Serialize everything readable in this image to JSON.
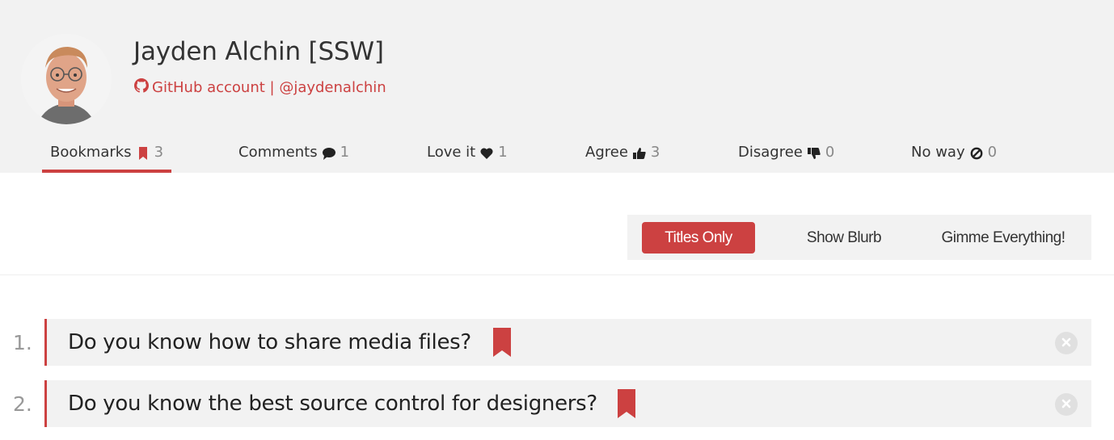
{
  "profile": {
    "name": "Jayden Alchin [SSW]",
    "github_text": "GitHub account | @jaydenalchin"
  },
  "tabs": [
    {
      "label": "Bookmarks",
      "count": "3",
      "icon": "bookmark-icon",
      "active": true
    },
    {
      "label": "Comments",
      "count": "1",
      "icon": "comment-icon",
      "active": false
    },
    {
      "label": "Love it",
      "count": "1",
      "icon": "heart-icon",
      "active": false
    },
    {
      "label": "Agree",
      "count": "3",
      "icon": "thumbs-up-icon",
      "active": false
    },
    {
      "label": "Disagree",
      "count": "0",
      "icon": "thumbs-down-icon",
      "active": false
    },
    {
      "label": "No way",
      "count": "0",
      "icon": "ban-icon",
      "active": false
    }
  ],
  "view_options": {
    "titles_only": "Titles Only",
    "show_blurb": "Show Blurb",
    "gimme_everything": "Gimme Everything!",
    "selected": "Titles Only"
  },
  "bookmarks": [
    {
      "number": "1.",
      "title": "Do you know how to share media files?"
    },
    {
      "number": "2.",
      "title": "Do you know the best source control for designers?"
    }
  ],
  "colors": {
    "accent": "#cc4141",
    "header_bg": "#f2f2f2",
    "row_bg": "#f2f2f2"
  }
}
